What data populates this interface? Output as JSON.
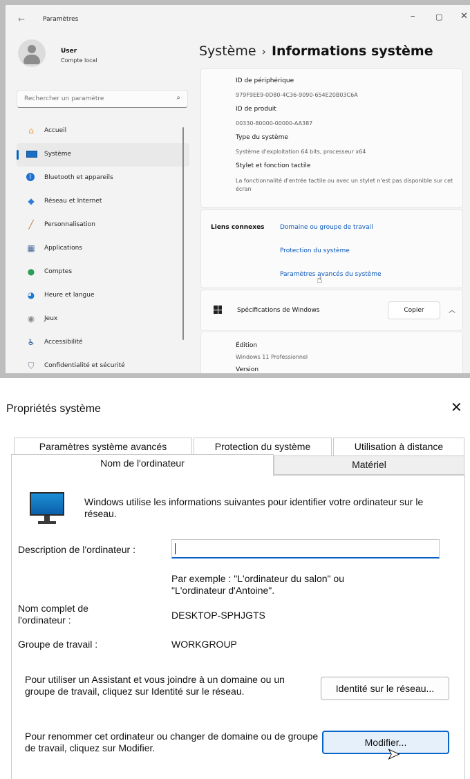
{
  "settings": {
    "app_title": "Paramètres",
    "window_controls": {
      "minimize": "–",
      "maximize": "▢",
      "close": "✕"
    },
    "user": {
      "name": "User",
      "account_type": "Compte local"
    },
    "search": {
      "placeholder": "Rechercher un paramètre"
    },
    "nav": [
      {
        "label": "Accueil",
        "icon": "home-icon"
      },
      {
        "label": "Système",
        "icon": "system-icon",
        "active": true
      },
      {
        "label": "Bluetooth et appareils",
        "icon": "bluetooth-icon"
      },
      {
        "label": "Réseau et Internet",
        "icon": "network-icon"
      },
      {
        "label": "Personnalisation",
        "icon": "brush-icon"
      },
      {
        "label": "Applications",
        "icon": "apps-icon"
      },
      {
        "label": "Comptes",
        "icon": "accounts-icon"
      },
      {
        "label": "Heure et langue",
        "icon": "globe-icon"
      },
      {
        "label": "Jeux",
        "icon": "gamepad-icon"
      },
      {
        "label": "Accessibilité",
        "icon": "accessibility-icon"
      },
      {
        "label": "Confidentialité et sécurité",
        "icon": "shield-icon"
      }
    ],
    "breadcrumb": {
      "parent": "Système",
      "separator": "›",
      "current": "Informations système"
    },
    "specs": [
      {
        "label": "ID de périphérique",
        "value": "979F9EE9-0D80-4C36-9090-654E20B03C6A"
      },
      {
        "label": "ID de produit",
        "value": "00330-80000-00000-AA387"
      },
      {
        "label": "Type du système",
        "value": "Système d'exploitation 64 bits, processeur x64"
      },
      {
        "label": "Stylet et fonction tactile",
        "value": "La fonctionnalité d'entrée tactile ou avec un stylet n'est pas disponible sur cet écran"
      }
    ],
    "related_links": {
      "title": "Liens connexes",
      "links": [
        "Domaine ou groupe de travail",
        "Protection du système",
        "Paramètres avancés du système"
      ]
    },
    "windows_specs": {
      "title": "Spécifications de Windows",
      "copy_label": "Copier",
      "edition_label": "Édition",
      "edition_value": "Windows 11 Professionnel",
      "version_label": "Version"
    },
    "colors": {
      "accent": "#0067c0",
      "link": "#0a56b8",
      "window_bg": "#f3f3f3"
    }
  },
  "dialog": {
    "title": "Propriétés système",
    "close": "✕",
    "tabs_back": [
      "Paramètres système avancés",
      "Protection du système",
      "Utilisation à distance"
    ],
    "tabs_front": [
      "Nom de l'ordinateur",
      "Matériel"
    ],
    "intro": "Windows utilise les informations suivantes pour identifier votre ordinateur sur le réseau.",
    "description_label": "Description de l'ordinateur :",
    "description_value": "",
    "example": "Par exemple : \"L'ordinateur du salon\" ou \"L'ordinateur d'Antoine\".",
    "full_name_label": "Nom complet de l'ordinateur :",
    "full_name_value": "DESKTOP-SPHJGTS",
    "workgroup_label": "Groupe de travail :",
    "workgroup_value": "WORKGROUP",
    "wizard_text": "Pour utiliser un Assistant et vous joindre à un domaine ou un groupe de travail, cliquez sur Identité sur le réseau.",
    "network_id_button": "Identité sur le réseau...",
    "rename_text": "Pour renommer cet ordinateur ou changer de domaine ou de groupe de travail, cliquez sur Modifier.",
    "modify_button": "Modifier...",
    "colors": {
      "focus": "#0a63c9"
    }
  }
}
